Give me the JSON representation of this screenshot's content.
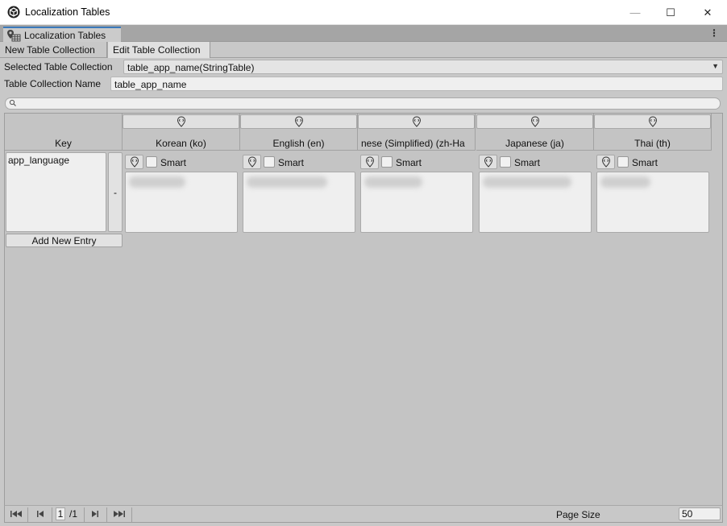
{
  "window": {
    "title": "Localization Tables",
    "controls": {
      "minimize": "—",
      "maximize": "☐",
      "close": "✕"
    },
    "tab_label": "Localization Tables"
  },
  "mode_tabs": [
    {
      "label": "New Table Collection",
      "active": false
    },
    {
      "label": "Edit Table Collection",
      "active": true
    }
  ],
  "fields": {
    "selected_label": "Selected Table Collection",
    "selected_value": "table_app_name(StringTable)",
    "name_label": "Table Collection Name",
    "name_value": "table_app_name"
  },
  "search": {
    "placeholder": ""
  },
  "table": {
    "key_header": "Key",
    "columns": [
      {
        "label": "Korean (ko)"
      },
      {
        "label": "English (en)"
      },
      {
        "label": "nese (Simplified) (zh-Ha"
      },
      {
        "label": "Japanese (ja)"
      },
      {
        "label": "Thai (th)"
      }
    ],
    "smart_label": "Smart",
    "rows": [
      {
        "key": "app_language",
        "remove_label": "-"
      }
    ],
    "add_entry_label": "Add New Entry"
  },
  "footer": {
    "current_page": "1",
    "total_pages": "/1",
    "page_size_label": "Page Size",
    "page_size_value": "50"
  },
  "colors": {
    "accent": "#3a79bb",
    "panel": "#c8c8c8"
  }
}
